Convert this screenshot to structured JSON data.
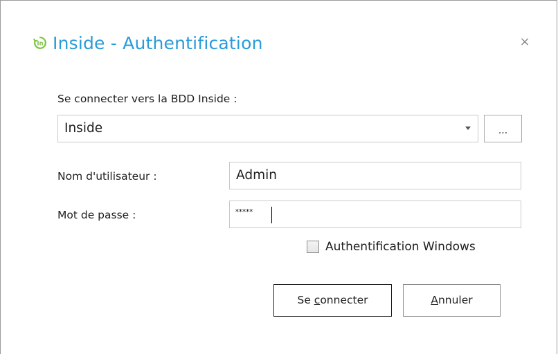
{
  "window": {
    "title": "Inside - Authentification",
    "app_icon": "inside-logo-icon",
    "close_label": "×",
    "accent_color": "#2a9bd8"
  },
  "form": {
    "connect_label": "Se connecter vers la BDD Inside :",
    "database_selected": "Inside",
    "browse_label": "...",
    "username_label": "Nom d'utilisateur :",
    "username_value": "Admin",
    "password_label": "Mot de passe :",
    "password_value": "*****",
    "windows_auth_label": "Authentification Windows",
    "windows_auth_checked": false
  },
  "buttons": {
    "connect_prefix": "Se ",
    "connect_mnemonic": "c",
    "connect_suffix": "onnecter",
    "cancel_mnemonic": "A",
    "cancel_suffix": "nnuler"
  }
}
